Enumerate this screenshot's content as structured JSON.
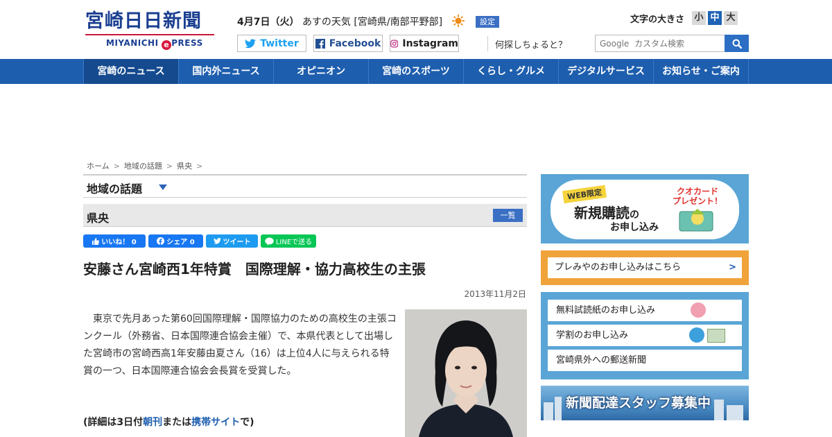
{
  "header": {
    "logo_main": "宮崎日日新聞",
    "logo_sub_left": "MIYANICHI",
    "logo_sub_e": "e",
    "logo_sub_right": "PRESS",
    "date": "4月7日（火）",
    "weather_text": "あすの天気 [宮崎県/南部平野部]",
    "weather_icon": "sun-icon",
    "settings_label": "設定",
    "fontsize_label": "文字の大きさ",
    "fontsize_options": [
      "小",
      "中",
      "大"
    ],
    "fontsize_selected": "中",
    "social": {
      "twitter": "Twitter",
      "facebook": "Facebook",
      "instagram": "Instagram"
    },
    "search_label": "何探しちょると？",
    "search_placeholder": "Google  カスタム検索"
  },
  "nav": {
    "items": [
      "宮崎のニュース",
      "国内外ニュース",
      "オピニオン",
      "宮崎のスポーツ",
      "くらし・グルメ",
      "デジタルサービス",
      "お知らせ・ご案内"
    ],
    "active": "宮崎のニュース"
  },
  "breadcrumb": [
    "ホーム",
    "地域の話題",
    "県央"
  ],
  "section_title": "地域の話題",
  "category": {
    "title": "県央",
    "list_label": "一覧"
  },
  "share": {
    "like": "いいね！ 0",
    "fb_share": "シェア 0",
    "tweet": "ツイート",
    "line": "LINEで送る"
  },
  "article": {
    "headline": "安藤さん宮崎西1年特賞　国際理解・協力高校生の主張",
    "date": "2013年11月2日",
    "body": "東京で先月あった第60回国際理解・国際協力のための高校生の主張コンクール（外務省、日本国際連合協会主催）で、本県代表として出場した宮崎市の宮崎西高1年安藤由夏さん（16）は上位4人に与えられる特賞の一つ、日本国際連合協会会長賞を受賞した。",
    "detail_prefix": "(詳細は3日付",
    "detail_link1": "朝刊",
    "detail_mid": "または",
    "detail_link2": "携帯サイト",
    "detail_suffix": "で)"
  },
  "sidebar": {
    "ad1": {
      "badge": "WEB限定",
      "main": "新規購読",
      "no": "の",
      "sub": "お申し込み",
      "quo": "クオカード\nプレゼント！"
    },
    "premi": "プレみやのお申し込みはこちら",
    "links": [
      "無料試読紙のお申し込み",
      "学割のお申し込み",
      "宮崎県外への郵送新聞"
    ],
    "recruit": "新聞配達スタッフ募集中"
  },
  "colors": {
    "brand": "#1b3f91",
    "nav": "#1e5eae",
    "accent_red": "#c9163a",
    "sidebar_blue": "#5aa5d6",
    "orange": "#f0a33b"
  }
}
